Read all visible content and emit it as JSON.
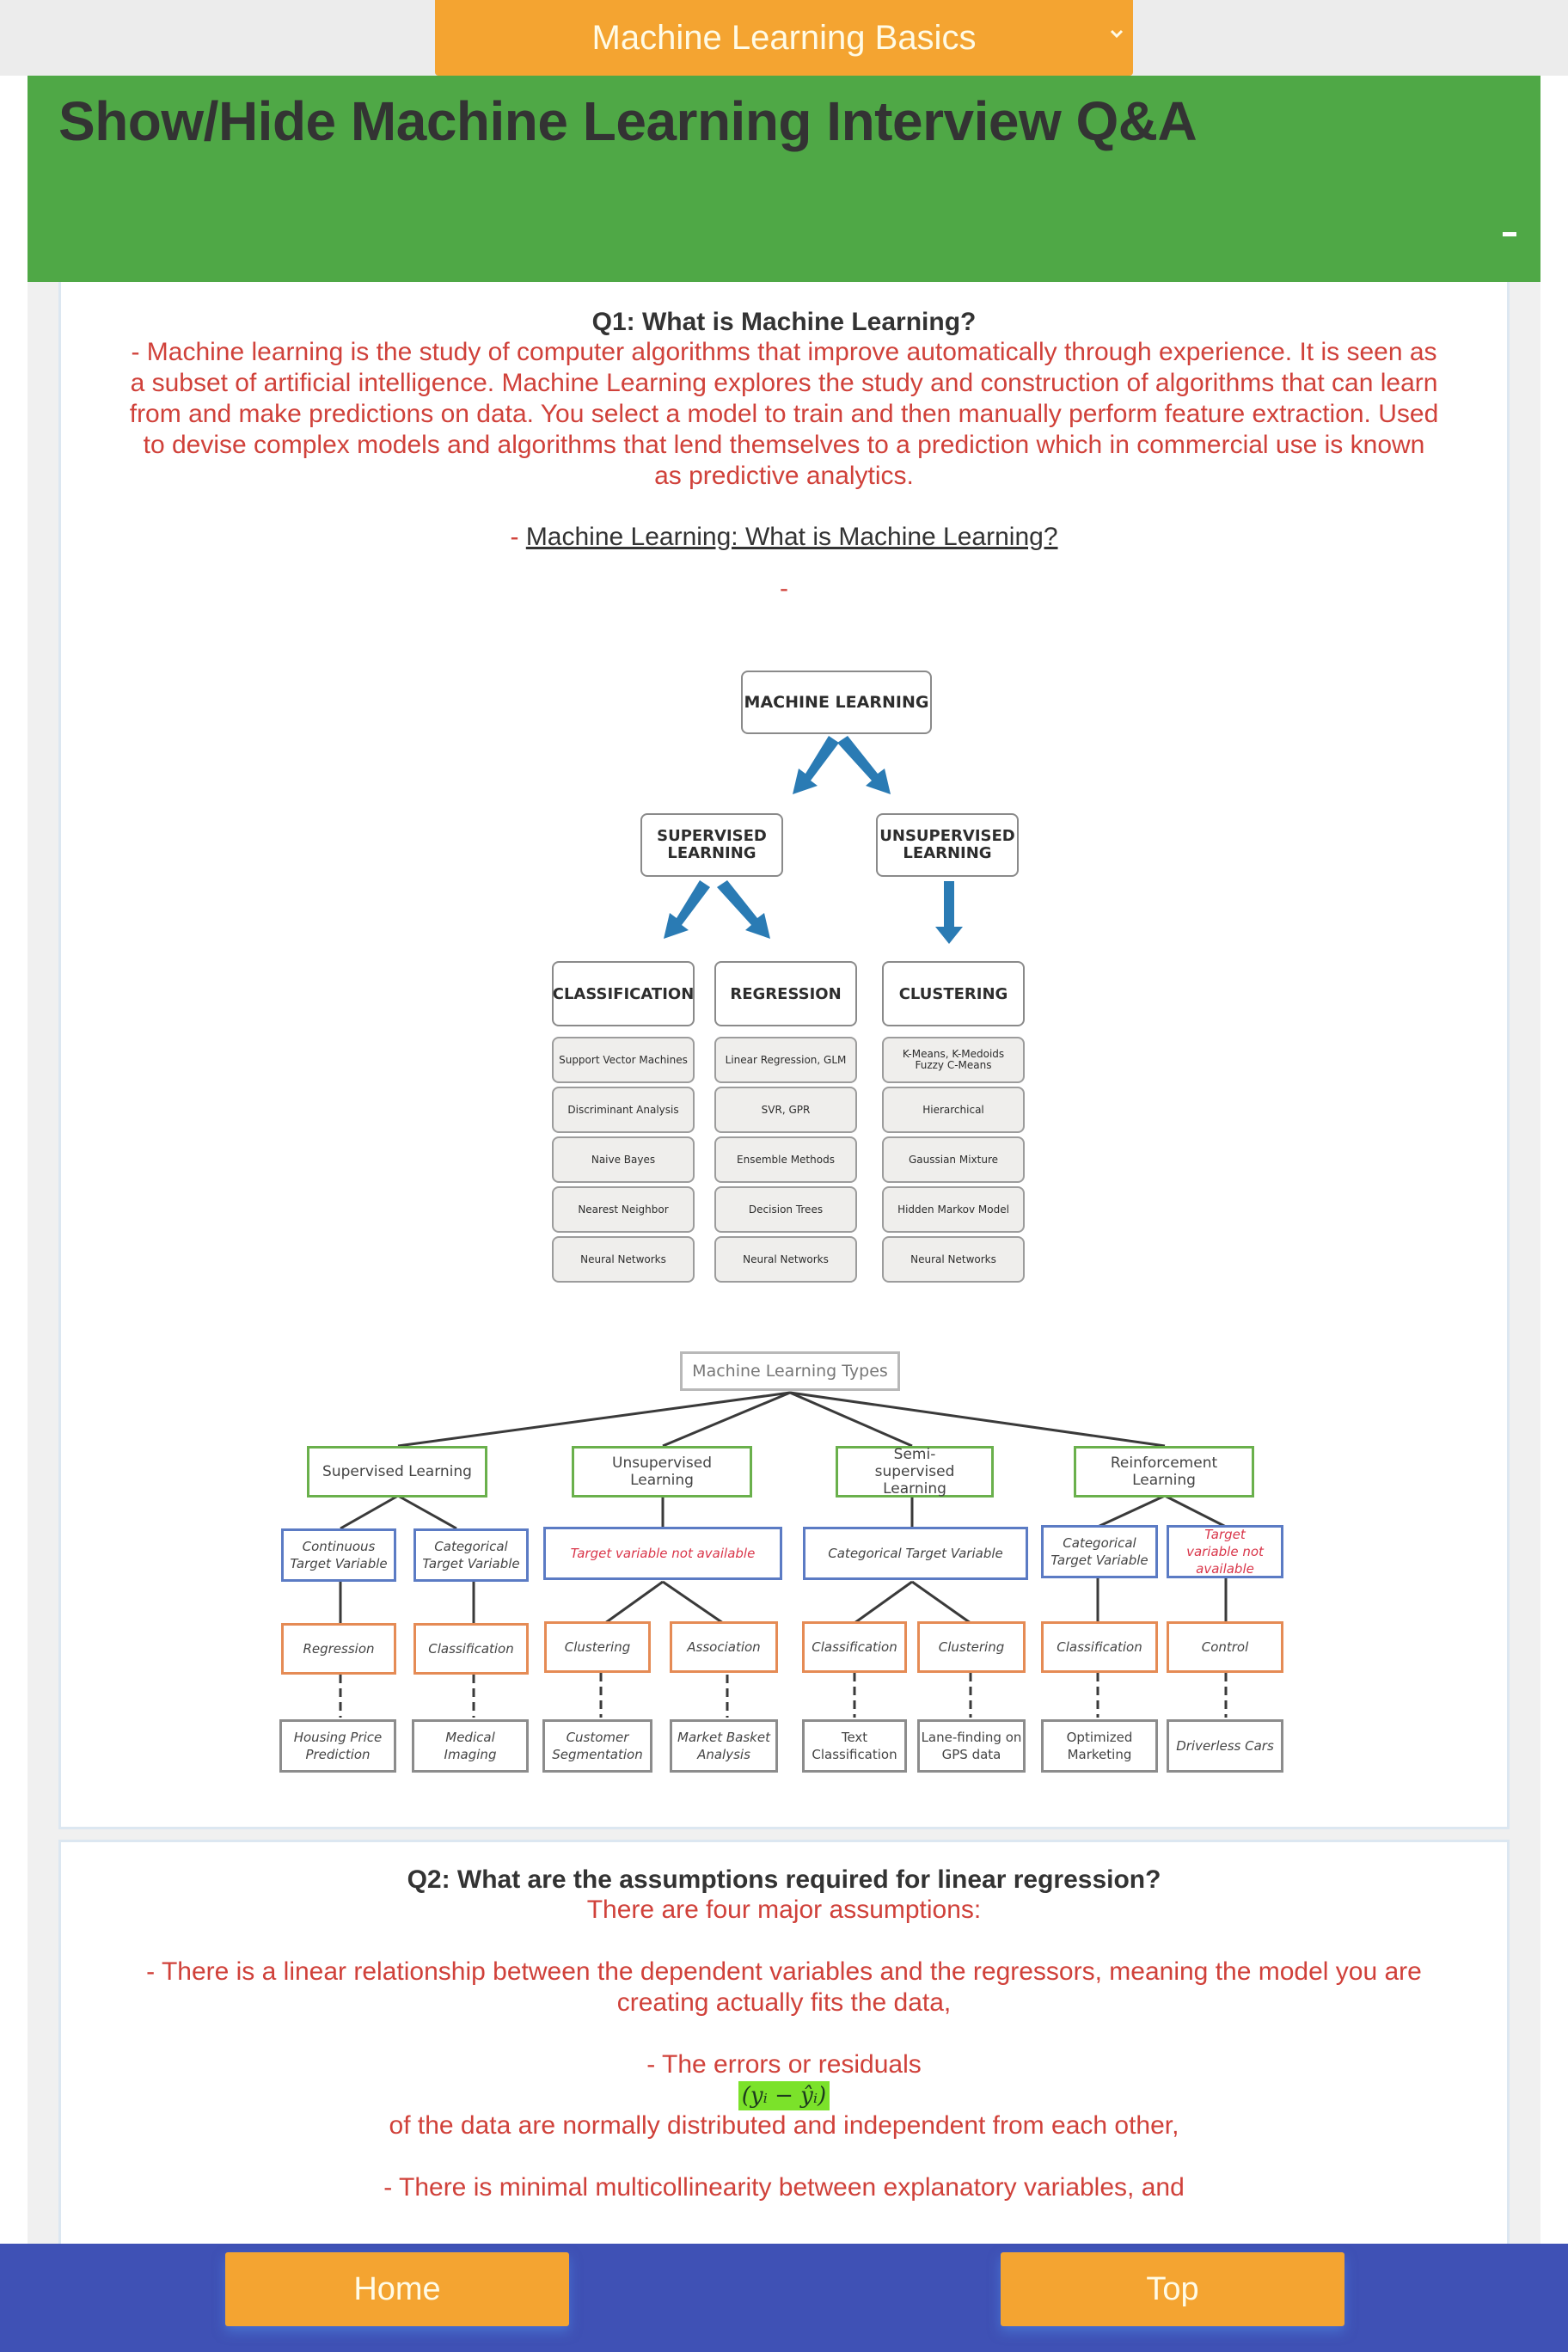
{
  "topic_select": {
    "selected": "Machine Learning Basics",
    "icon": "chevron-down-icon"
  },
  "header": {
    "title": "Show/Hide Machine Learning Interview Q&A",
    "toggle_icon": "minus-icon"
  },
  "q1": {
    "title": "Q1: What is Machine Learning?",
    "answer_lines": [
      "- Machine learning is the study of computer algorithms that improve automatically through experience. It is seen as",
      "a subset of artificial intelligence. Machine Learning explores the study and construction of algorithms that can learn",
      "from and make predictions on data. You select a model to train and then manually perform feature extraction. Used",
      "to devise complex models and algorithms that lend themselves to a prediction which in commercial use is known",
      "as predictive analytics."
    ],
    "link_prefix": "- ",
    "link_text": "Machine Learning: What is Machine Learning? ",
    "dash": "-",
    "diagram1": {
      "root": "MACHINE LEARNING",
      "supervised": "SUPERVISED LEARNING",
      "unsupervised": "UNSUPERVISED LEARNING",
      "columns": [
        {
          "header": "CLASSIFICATION",
          "items": [
            "Support Vector Machines",
            "Discriminant Analysis",
            "Naive Bayes",
            "Nearest Neighbor",
            "Neural Networks"
          ]
        },
        {
          "header": "REGRESSION",
          "items": [
            "Linear Regression, GLM",
            "SVR, GPR",
            "Ensemble Methods",
            "Decision Trees",
            "Neural Networks"
          ]
        },
        {
          "header": "CLUSTERING",
          "items": [
            "K-Means, K-Medoids Fuzzy C-Means",
            "Hierarchical",
            "Gaussian Mixture",
            "Hidden Markov Model",
            "Neural Networks"
          ]
        }
      ]
    },
    "diagram2": {
      "root": "Machine Learning Types",
      "types": [
        "Supervised Learning",
        "Unsupervised Learning",
        "Semi-supervised Learning",
        "Reinforcement Learning"
      ],
      "targets": [
        "Continuous Target Variable",
        "Categorical Target Variable",
        "Target variable not available",
        "Categorical Target Variable",
        "Categorical Target Variable",
        "Target variable not available"
      ],
      "tasks": [
        "Regression",
        "Classification",
        "Clustering",
        "Association",
        "Classification",
        "Clustering",
        "Classification",
        "Control"
      ],
      "applications": [
        "Housing Price Prediction",
        "Medical Imaging",
        "Customer Segmentation",
        "Market Basket Analysis",
        "Text Classification",
        "Lane-finding on GPS data",
        "Optimized Marketing",
        "Driverless Cars"
      ]
    }
  },
  "q2": {
    "title": "Q2: What are the assumptions required for linear regression?",
    "intro": "There are four major assumptions:",
    "point1_lines": [
      "- There is a linear relationship between the dependent variables and the regressors, meaning the model you are",
      "creating actually fits the data,"
    ],
    "point2_a": "- The errors or residuals",
    "point2_math": "(yᵢ −  ŷᵢ)",
    "point2_b": "of the data are normally distributed and independent from each other,",
    "point3": "- There is minimal multicollinearity between explanatory variables, and"
  },
  "footer": {
    "home_label": "Home",
    "top_label": "Top"
  }
}
